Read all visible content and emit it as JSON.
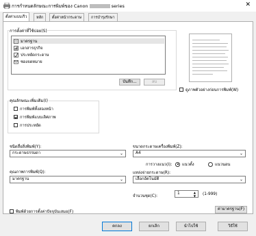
{
  "window": {
    "title_prefix": "การกำหนดลักษณะการพิมพ์ของ Canon",
    "title_suffix": "series",
    "close_glyph": "✕"
  },
  "tabs": [
    {
      "label": "ตั้งค่าแบบเร็ว",
      "active": true
    },
    {
      "label": "หลัก",
      "active": false
    },
    {
      "label": "ตั้งค่าหน้ากระดาษ",
      "active": false
    },
    {
      "label": "การบำรุงรักษา",
      "active": false
    }
  ],
  "common_settings": {
    "group_label": "การตั้งค่าที่ใช้บ่อย(S)",
    "items": [
      {
        "label": "มาตรฐาน",
        "icon": "standard-doc-icon",
        "selected": true
      },
      {
        "label": "เอกสารธุรกิจ",
        "icon": "business-doc-icon",
        "selected": false
      },
      {
        "label": "ประหยัดกระดาษ",
        "icon": "paper-saving-icon",
        "selected": false
      },
      {
        "label": "ซองจดหมาย",
        "icon": "envelope-icon",
        "selected": false
      }
    ],
    "save_button": "บันทึก...",
    "delete_button": "ลบ"
  },
  "preview": {
    "always_print_label": "ดูภาพตัวอย่างก่อนการพิมพ์(W)",
    "checked": false
  },
  "additional_features": {
    "group_label": "คุณลักษณะเพิ่มเติม(I)",
    "items": [
      {
        "label": "การพิมพ์ทั้งสองหน้า",
        "checked": false
      },
      {
        "label": "การพิมพ์แบบเลิศภาพ",
        "checked": true
      },
      {
        "label": "การประหยัด",
        "checked": false
      }
    ]
  },
  "media_type": {
    "label": "ชนิดสื่อสิ่งพิมพ์(Y):",
    "value": "กระดาษธรรมดา"
  },
  "print_quality": {
    "label": "คุณภาพการพิมพ์(Q):",
    "value": "มาตรฐาน"
  },
  "printer_paper_size": {
    "label": "ขนาดกระดาษเครื่องพิมพ์(Z):",
    "value": "A4"
  },
  "orientation": {
    "label": "การวางแนว(I):",
    "options": [
      "แนวตั้ง",
      "แนวนอน"
    ],
    "selected": 0
  },
  "paper_source": {
    "label": "แหล่งจ่ายกระดาษ(R):",
    "value": "เลือกอัตโนมัติ"
  },
  "copies": {
    "label": "จำนวนชุด(C):",
    "value": "1",
    "range": "(1-999)"
  },
  "always_print_current": {
    "label": "พิมพ์ด้วยการตั้งค่าปัจจุบันเสมอ(F)",
    "checked": false
  },
  "defaults_button": "ค่ามาตรฐาน(F)",
  "footer": {
    "ok": "ตกลง",
    "cancel": "ยกเลิก",
    "apply": "นำไปใช้",
    "help": "วิธีใช้"
  }
}
